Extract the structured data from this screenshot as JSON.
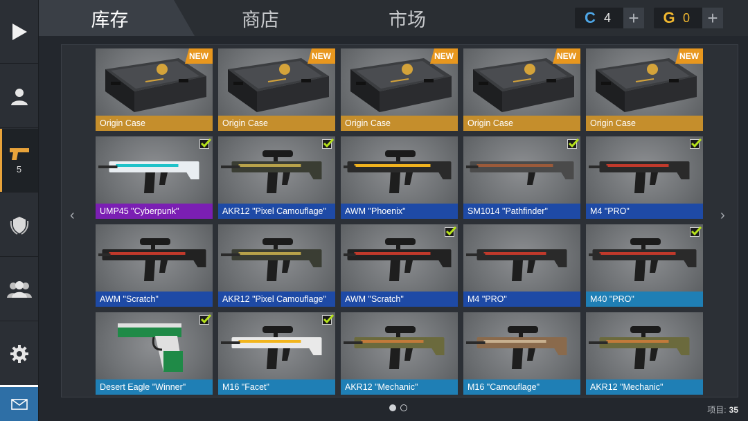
{
  "sidebar": {
    "items": [
      {
        "name": "play",
        "icon": "play-icon"
      },
      {
        "name": "profile",
        "icon": "person-icon"
      },
      {
        "name": "weapons",
        "icon": "pistol-icon",
        "badge": "5",
        "active": true
      },
      {
        "name": "rank",
        "icon": "shield-laurel-icon"
      },
      {
        "name": "friends",
        "icon": "group-icon"
      },
      {
        "name": "settings",
        "icon": "gear-icon"
      }
    ],
    "mail_icon": "mail-icon"
  },
  "header": {
    "tabs": [
      {
        "label": "库存",
        "active": true
      },
      {
        "label": "商店",
        "active": false
      },
      {
        "label": "市场",
        "active": false
      }
    ],
    "currencies": [
      {
        "icon_letter": "C",
        "value": "4",
        "color": "#4ea6e6"
      },
      {
        "icon_letter": "G",
        "value": "0",
        "color": "#f0b72f"
      }
    ],
    "add_symbol": "+"
  },
  "nav": {
    "prev": "‹",
    "next": "›"
  },
  "items": [
    {
      "label": "Origin Case",
      "rarity": "gold",
      "kind": "case",
      "new": true,
      "checked": false
    },
    {
      "label": "Origin Case",
      "rarity": "gold",
      "kind": "case",
      "new": true,
      "checked": false
    },
    {
      "label": "Origin Case",
      "rarity": "gold",
      "kind": "case",
      "new": true,
      "checked": false
    },
    {
      "label": "Origin Case",
      "rarity": "gold",
      "kind": "case",
      "new": true,
      "checked": false
    },
    {
      "label": "Origin Case",
      "rarity": "gold",
      "kind": "case",
      "new": true,
      "checked": false
    },
    {
      "label": "UMP45 \"Cyberpunk\"",
      "rarity": "purple",
      "kind": "smg",
      "skin": "cyber",
      "new": false,
      "checked": true
    },
    {
      "label": "AKR12 \"Pixel Camouflage\"",
      "rarity": "blue",
      "kind": "rifle",
      "skin": "pixel",
      "new": false,
      "checked": true
    },
    {
      "label": "AWM \"Phoenix\"",
      "rarity": "blue",
      "kind": "sniper",
      "skin": "phoenix",
      "new": false,
      "checked": false
    },
    {
      "label": "SM1014 \"Pathfinder\"",
      "rarity": "blue",
      "kind": "shotgun",
      "skin": "pathfinder",
      "new": false,
      "checked": true
    },
    {
      "label": "M4 \"PRO\"",
      "rarity": "blue",
      "kind": "rifle",
      "skin": "pro",
      "new": false,
      "checked": true
    },
    {
      "label": "AWM \"Scratch\"",
      "rarity": "blue",
      "kind": "sniper",
      "skin": "scratch",
      "new": false,
      "checked": false
    },
    {
      "label": "AKR12 \"Pixel Camouflage\"",
      "rarity": "blue",
      "kind": "rifle",
      "skin": "pixel",
      "new": false,
      "checked": false
    },
    {
      "label": "AWM \"Scratch\"",
      "rarity": "blue",
      "kind": "sniper",
      "skin": "scratch",
      "new": false,
      "checked": true
    },
    {
      "label": "M4 \"PRO\"",
      "rarity": "blue",
      "kind": "rifle",
      "skin": "pro",
      "new": false,
      "checked": false
    },
    {
      "label": "M40 \"PRO\"",
      "rarity": "lblue",
      "kind": "sniper",
      "skin": "pro",
      "new": false,
      "checked": true
    },
    {
      "label": "Desert Eagle \"Winner\"",
      "rarity": "lblue",
      "kind": "pistol",
      "skin": "winner",
      "new": false,
      "checked": true
    },
    {
      "label": "M16 \"Facet\"",
      "rarity": "lblue",
      "kind": "rifle",
      "skin": "facet",
      "new": false,
      "checked": true
    },
    {
      "label": "AKR12 \"Mechanic\"",
      "rarity": "lblue",
      "kind": "rifle",
      "skin": "mechanic",
      "new": false,
      "checked": false
    },
    {
      "label": "M16 \"Camouflage\"",
      "rarity": "lblue",
      "kind": "rifle",
      "skin": "camo",
      "new": false,
      "checked": false
    },
    {
      "label": "AKR12 \"Mechanic\"",
      "rarity": "lblue",
      "kind": "rifle",
      "skin": "mechanic",
      "new": false,
      "checked": false
    }
  ],
  "new_badge": "NEW",
  "pagination": {
    "pages": 2,
    "current": 1
  },
  "footer": {
    "count_label": "项目:",
    "count_value": "35"
  },
  "colors": {
    "gold": "#c58e2c",
    "purple": "#7b1fb3",
    "blue": "#1e4aa6",
    "lblue": "#1f7fb5",
    "accent": "#e8a33a"
  }
}
